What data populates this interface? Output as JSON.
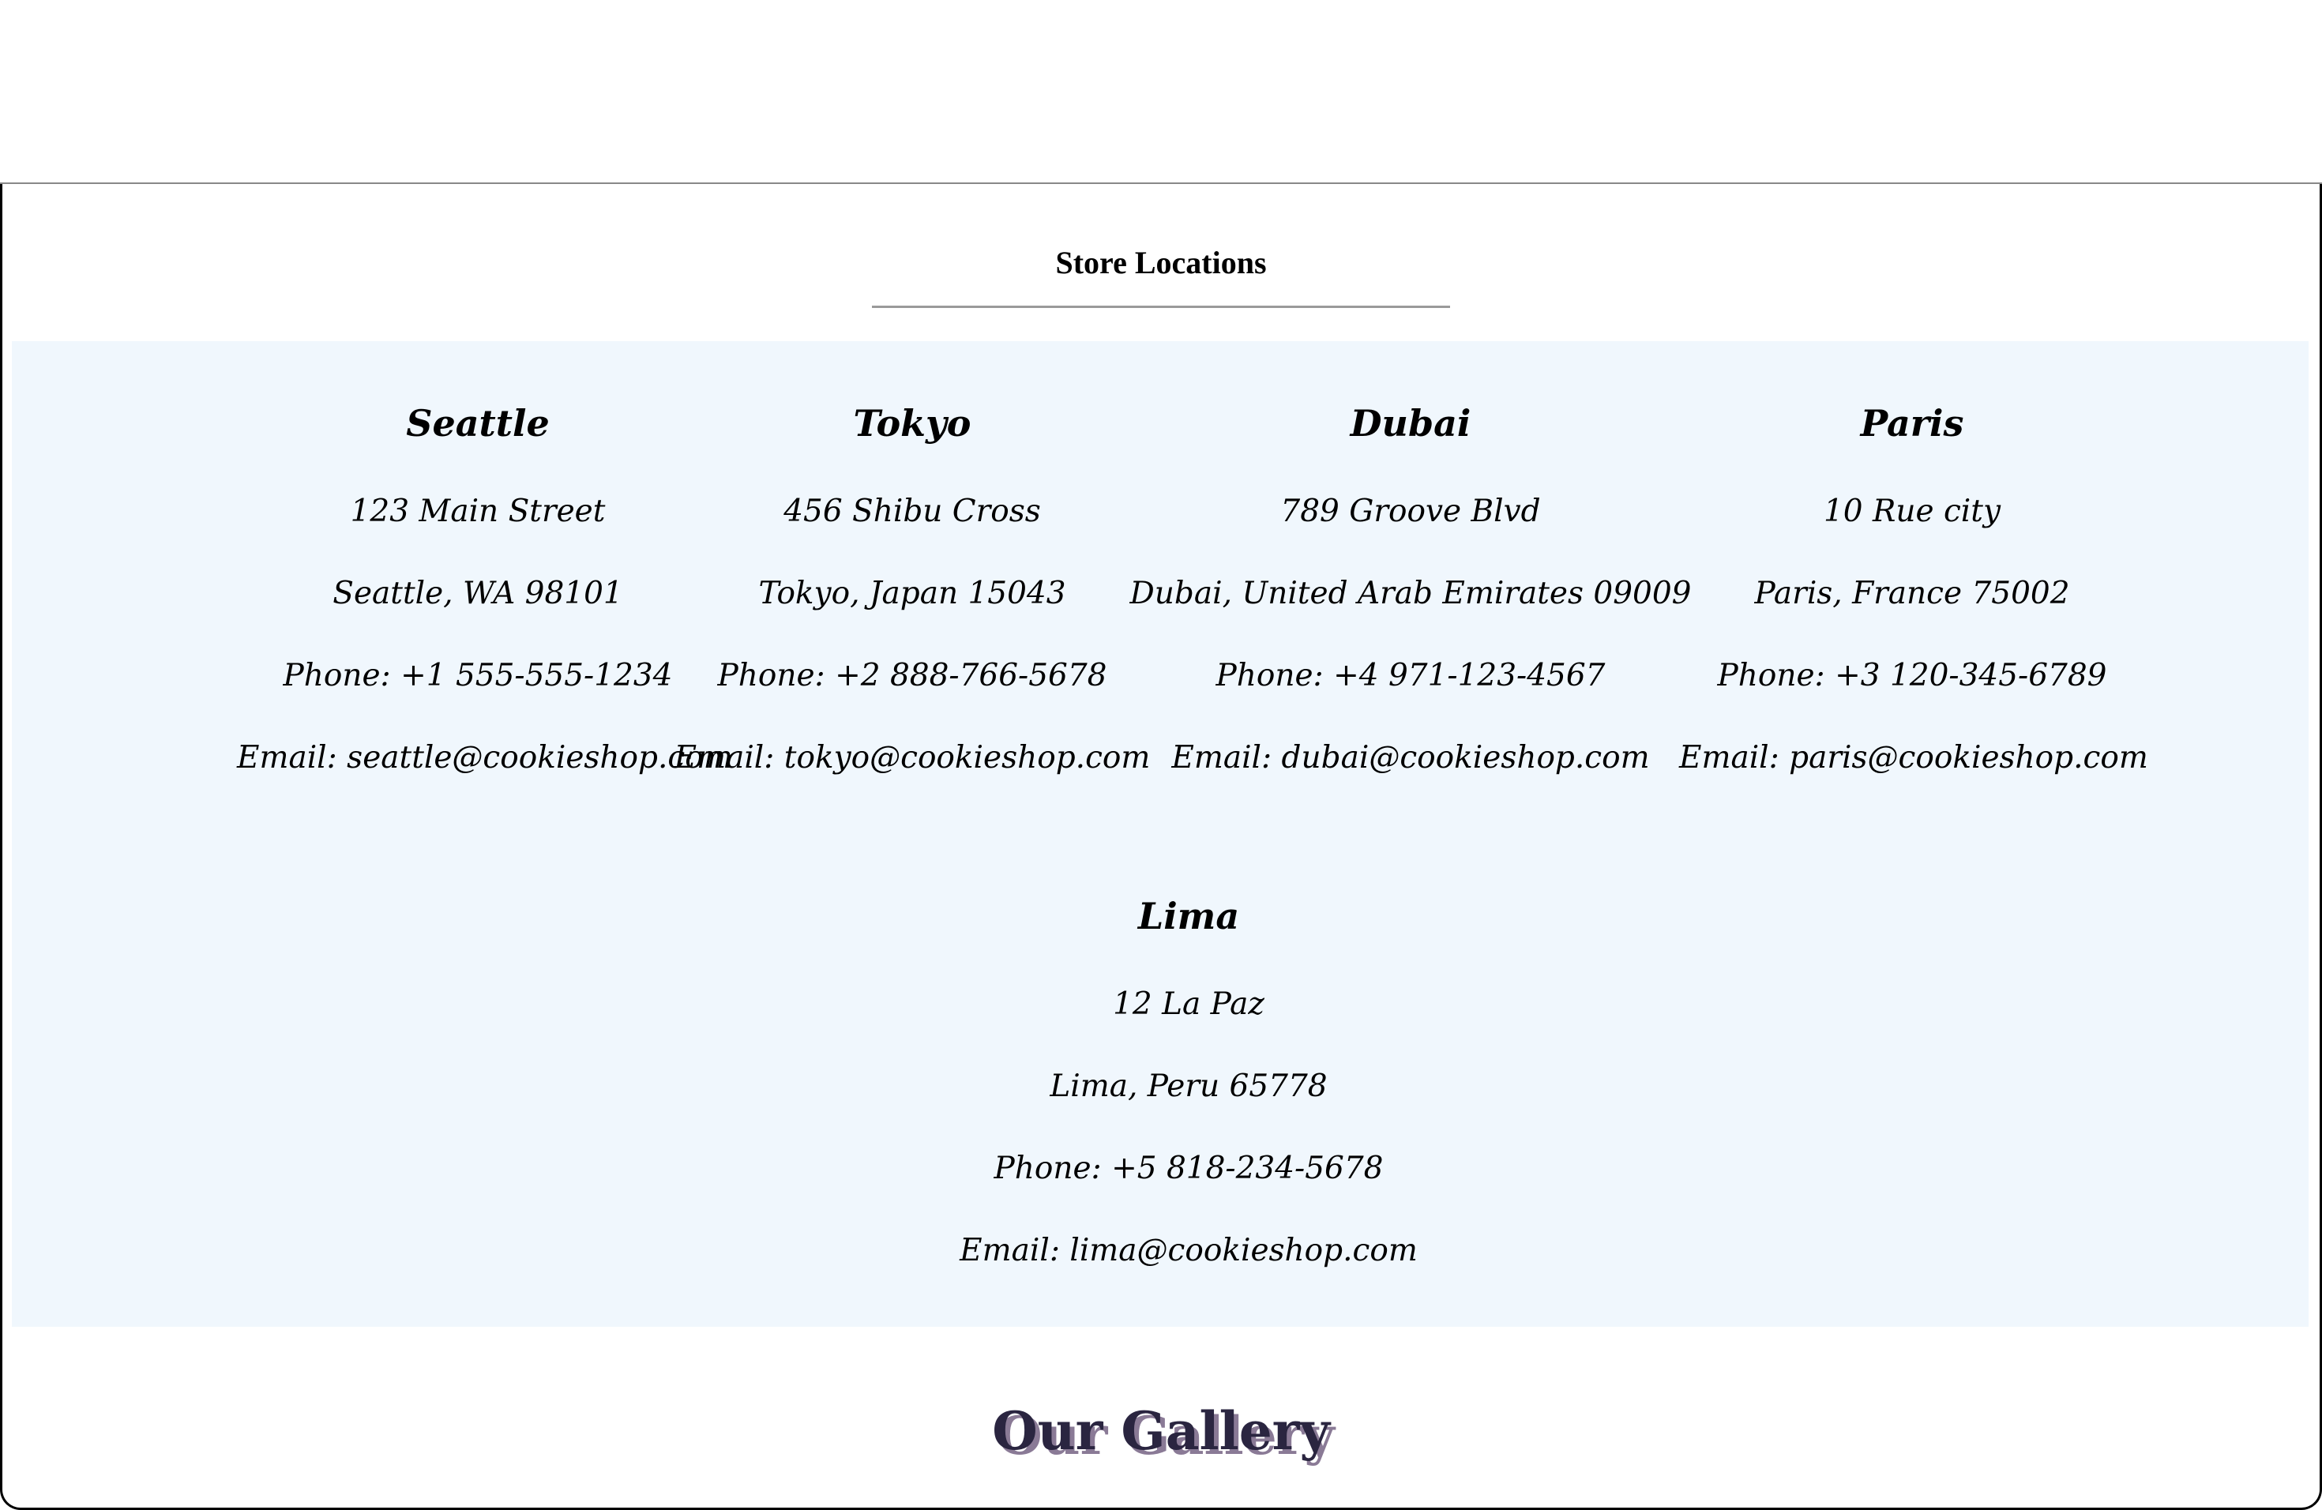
{
  "section": {
    "store_locations_title": "Store Locations"
  },
  "locations": [
    {
      "city": "Seattle",
      "address": "123 Main Street",
      "region": "Seattle, WA 98101",
      "phone": "Phone: +1 555-555-1234",
      "email": "Email: seattle@cookieshop.com"
    },
    {
      "city": "Tokyo",
      "address": "456 Shibu Cross",
      "region": "Tokyo, Japan 15043",
      "phone": "Phone: +2 888-766-5678",
      "email": "Email: tokyo@cookieshop.com"
    },
    {
      "city": "Dubai",
      "address": "789 Groove Blvd",
      "region": "Dubai, United Arab Emirates 09009",
      "phone": "Phone: +4 971-123-4567",
      "email": "Email: dubai@cookieshop.com"
    },
    {
      "city": "Paris",
      "address": "10 Rue city",
      "region": "Paris, France 75002",
      "phone": "Phone: +3 120-345-6789",
      "email": "Email: paris@cookieshop.com"
    },
    {
      "city": "Lima",
      "address": "12 La Paz",
      "region": "Lima, Peru 65778",
      "phone": "Phone: +5 818-234-5678",
      "email": "Email: lima@cookieshop.com"
    }
  ],
  "gallery": {
    "title": "Our Gallery"
  },
  "colors": {
    "panel_background": "#f0f7fd",
    "gallery_title": "#2a2540",
    "gallery_title_shadow": "#8a7a96",
    "divider": "#9a9a9a"
  }
}
